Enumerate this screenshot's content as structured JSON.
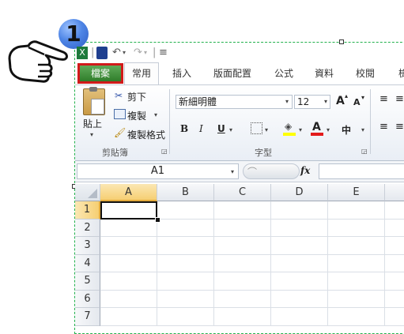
{
  "step_badge": "1",
  "tabs": [
    "檔案",
    "常用",
    "插入",
    "版面配置",
    "公式",
    "資料",
    "校閱",
    "檢"
  ],
  "clipboard": {
    "paste": "貼上",
    "cut": "剪下",
    "copy": "複製",
    "format_painter": "複製格式",
    "group": "剪貼簿"
  },
  "font": {
    "name": "新細明體",
    "size": "12",
    "bold": "B",
    "italic": "I",
    "underline": "U",
    "font_color_glyph": "A",
    "phonetic": "中",
    "grow": "A",
    "shrink": "A",
    "group": "字型"
  },
  "formula_bar": {
    "name_box": "A1",
    "fx": "fx"
  },
  "columns": [
    "A",
    "B",
    "C",
    "D",
    "E"
  ],
  "rows": [
    "1",
    "2",
    "3",
    "4",
    "5",
    "6",
    "7"
  ],
  "colors": {
    "file_tab": "#3f8f3a",
    "file_tab_outline": "#d11a1a",
    "selection_frame": "#22b14c",
    "active_header": "#f9d98b"
  }
}
